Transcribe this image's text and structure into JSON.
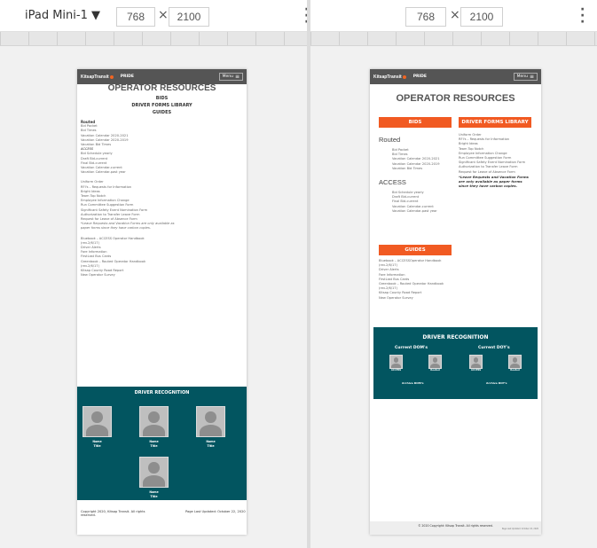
{
  "toolbar": {
    "device_name": "iPad Mini-1",
    "width": "768",
    "height": "2100",
    "times": "×"
  },
  "site": {
    "logo": "KitsapTransit",
    "nav_pride": "PRIDE",
    "menu_label": "Menu",
    "page_title": "OPERATOR RESOURCES"
  },
  "sections": {
    "bids": "BIDS",
    "forms": "DRIVER FORMS LIBRARY",
    "guides": "GUIDES"
  },
  "routed": {
    "heading": "Routed",
    "items": [
      "Bid Packet",
      "Bid Times",
      "Vacation Calendar 2020-2021",
      "Vacation Calendar 2020-2019",
      "Vacation Bid Times"
    ]
  },
  "access": {
    "heading": "ACCESS",
    "items": [
      "Bid Schedule yearly",
      "Draft Bid-current",
      "Final Bid-current",
      "Vacation Calendar-current",
      "Vacation Calendar-past year"
    ]
  },
  "forms_list": {
    "items": [
      "Uniform Order",
      "RFI's – Requests for Information",
      "Bright Ideas",
      "Team Top Notch",
      "Employee Information Change",
      "Run Committee Suggestion Form",
      "Significant Safety Event Nomination Form",
      "Authorization to Transfer Leave Form",
      "Request for Leave of Absence Form"
    ],
    "note": "*Leave Requests and Vacation Forms are only available as paper forms since they have carbon copies."
  },
  "guides_list": {
    "left_items": [
      "Bluebook – ACCESS Operator Handbook (rev.2/6/17)",
      "Driver Alerts",
      "Fare Information",
      "FirstLast Bus Cards",
      "Greenbook – Routed Operator Handbook (rev.2/6/17)",
      "Kitsap County Road Report",
      "New Operator Survey"
    ],
    "right_items": [
      "Bluebook – ACCESSOperator Handbook (rev.2/6/17)",
      "Driver Alerts",
      "Fare Information",
      "FirstLast Bus Cards",
      "Greenbook – Routed Operator Handbook (rev.2/6/17)",
      "Kitsap County Road Report",
      "New Operator Survey"
    ]
  },
  "recognition": {
    "title": "DRIVER RECOGNITION",
    "name": "Name",
    "role": "Title",
    "current_dom": "Current DOM's",
    "current_doy": "Current DOY's",
    "access": "ACCESS",
    "routed": "Routed",
    "archive_dom": "Archive DOM's",
    "archive_doy": "Archive DOY's"
  },
  "footer": {
    "left_copyright": "Copyright 2020, Kitsap Transit. All rights reserved.",
    "left_updated": "Page Last Updated: October 22, 2020",
    "right_copyright": "© 2020 Copyright: Kitsap Transit. All rights reserved.",
    "right_updated": "Page Last Updated: October 22, 2020"
  }
}
